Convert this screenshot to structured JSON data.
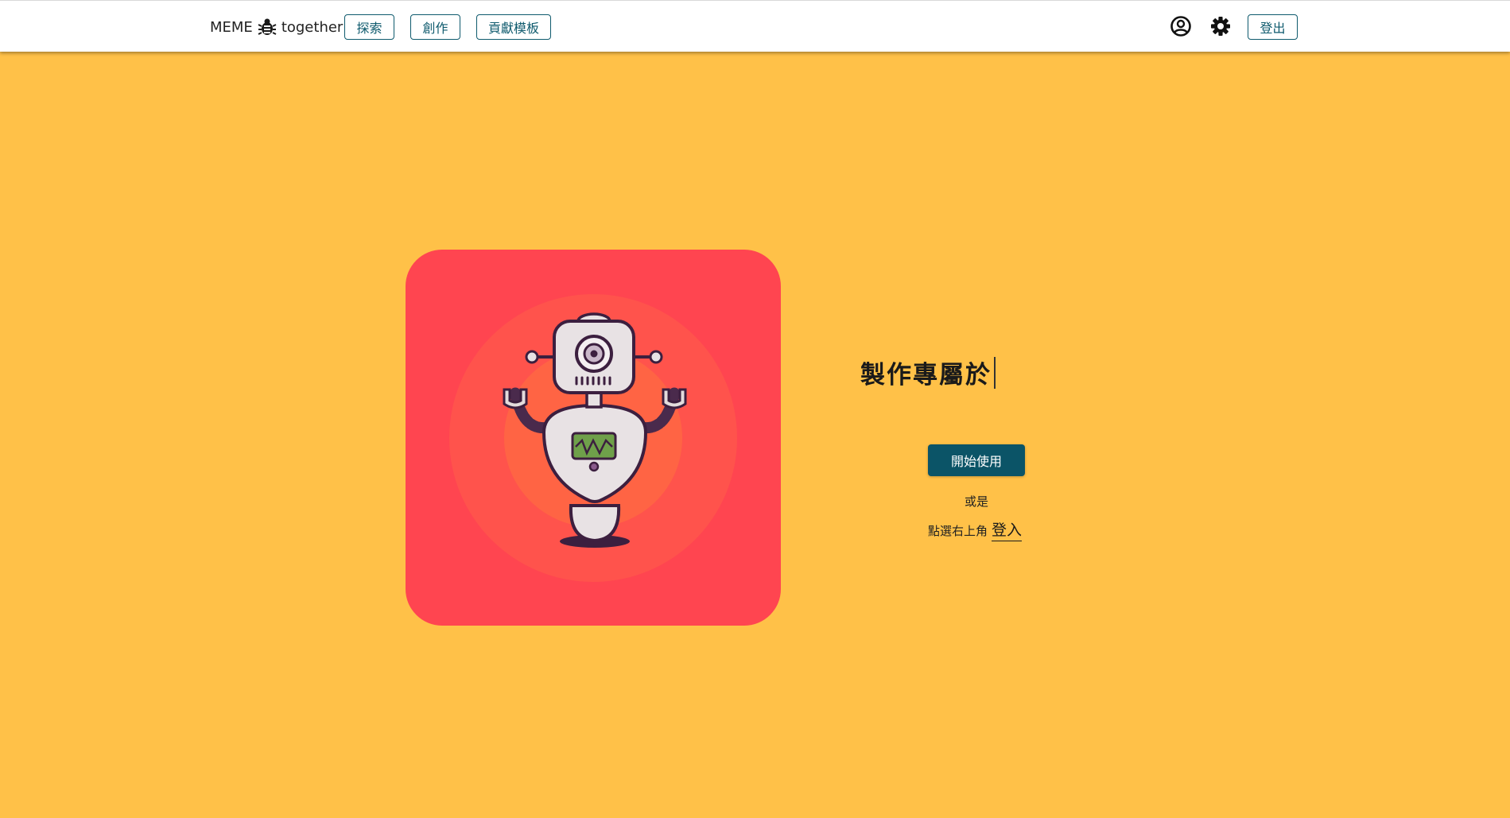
{
  "header": {
    "brand_left": "MEME",
    "brand_right": "together",
    "nav": [
      {
        "label": "探索"
      },
      {
        "label": "創作"
      },
      {
        "label": "貢獻模板"
      }
    ],
    "logout_label": "登出",
    "icons": [
      "account-circle-icon",
      "gear-icon"
    ]
  },
  "hero": {
    "headline": "製作專屬於",
    "start_button": "開始使用",
    "or_text": "或是",
    "login_prefix": "點選右上角",
    "login_link": "登入"
  },
  "colors": {
    "background": "#FFC148",
    "card": "#FF4550",
    "primary": "#0B5467",
    "nav_border": "#0E5A6D"
  }
}
